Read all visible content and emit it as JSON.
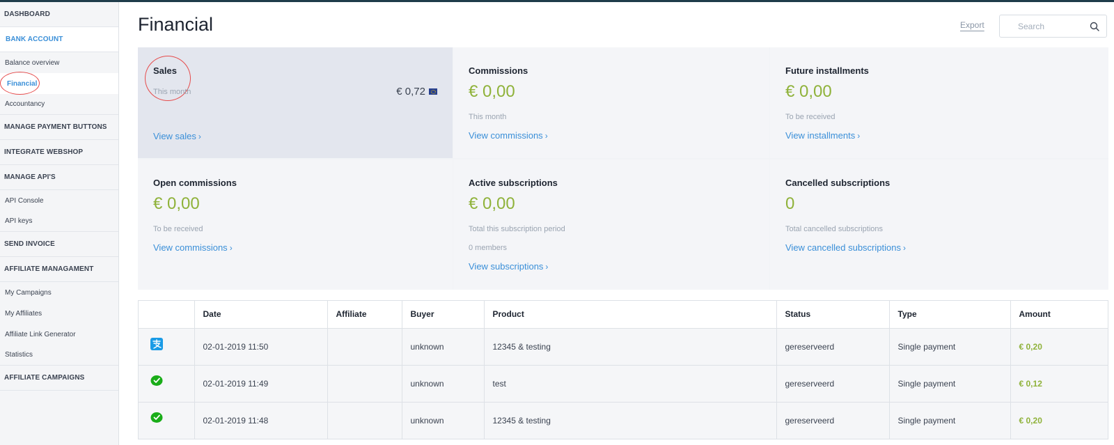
{
  "sidebar": {
    "dashboard": "DASHBOARD",
    "bank_account": "BANK ACCOUNT",
    "balance_overview": "Balance overview",
    "financial": "Financial",
    "accountancy": "Accountancy",
    "manage_payment_buttons": "MANAGE PAYMENT BUTTONS",
    "integrate_webshop": "INTEGRATE WEBSHOP",
    "manage_apis": "MANAGE API'S",
    "api_console": "API Console",
    "api_keys": "API keys",
    "send_invoice": "SEND INVOICE",
    "affiliate_managament": "AFFILIATE MANAGAMENT",
    "my_campaigns": "My Campaigns",
    "my_affiliates": "My Affiliates",
    "affiliate_link_generator": "Affiliate Link Generator",
    "statistics": "Statistics",
    "affiliate_campaigns": "AFFILIATE CAMPAIGNS"
  },
  "header": {
    "title": "Financial",
    "export": "Export",
    "search_placeholder": "Search"
  },
  "cards": {
    "sales": {
      "title": "Sales",
      "sub": "This month",
      "amount": "€ 0,72",
      "link": "View sales"
    },
    "commissions": {
      "title": "Commissions",
      "amount": "€ 0,00",
      "sub": "This month",
      "link": "View commissions"
    },
    "future": {
      "title": "Future installments",
      "amount": "€ 0,00",
      "sub": "To be received",
      "link": "View installments"
    },
    "open": {
      "title": "Open commissions",
      "amount": "€ 0,00",
      "sub": "To be received",
      "link": "View commissions"
    },
    "active": {
      "title": "Active subscriptions",
      "amount": "€ 0,00",
      "sub": "Total this subscription period",
      "sub2": "0 members",
      "link": "View subscriptions"
    },
    "cancelled": {
      "title": "Cancelled subscriptions",
      "amount": "0",
      "sub": "Total cancelled subscriptions",
      "link": "View cancelled subscriptions"
    }
  },
  "table": {
    "headers": [
      "",
      "Date",
      "Affiliate",
      "Buyer",
      "Product",
      "Status",
      "Type",
      "Amount"
    ],
    "rows": [
      {
        "method_icon": "alipay-icon",
        "date": "02-01-2019 11:50",
        "affiliate": "",
        "buyer": "unknown",
        "product": "12345 & testing",
        "status": "gereserveerd",
        "type": "Single payment",
        "amount": "€ 0,20"
      },
      {
        "method_icon": "wechat-pay-icon",
        "date": "02-01-2019 11:49",
        "affiliate": "",
        "buyer": "unknown",
        "product": "test",
        "status": "gereserveerd",
        "type": "Single payment",
        "amount": "€ 0,12"
      },
      {
        "method_icon": "wechat-pay-icon",
        "date": "02-01-2019 11:48",
        "affiliate": "",
        "buyer": "unknown",
        "product": "12345 & testing",
        "status": "gereserveerd",
        "type": "Single payment",
        "amount": "€ 0,20"
      }
    ]
  },
  "colors": {
    "accent_blue": "#3a8fd8",
    "amount_green": "#8fb23a",
    "annotation_red": "#e64b4b",
    "alipay_blue": "#1a9be6",
    "wechat_green": "#1aad19"
  }
}
